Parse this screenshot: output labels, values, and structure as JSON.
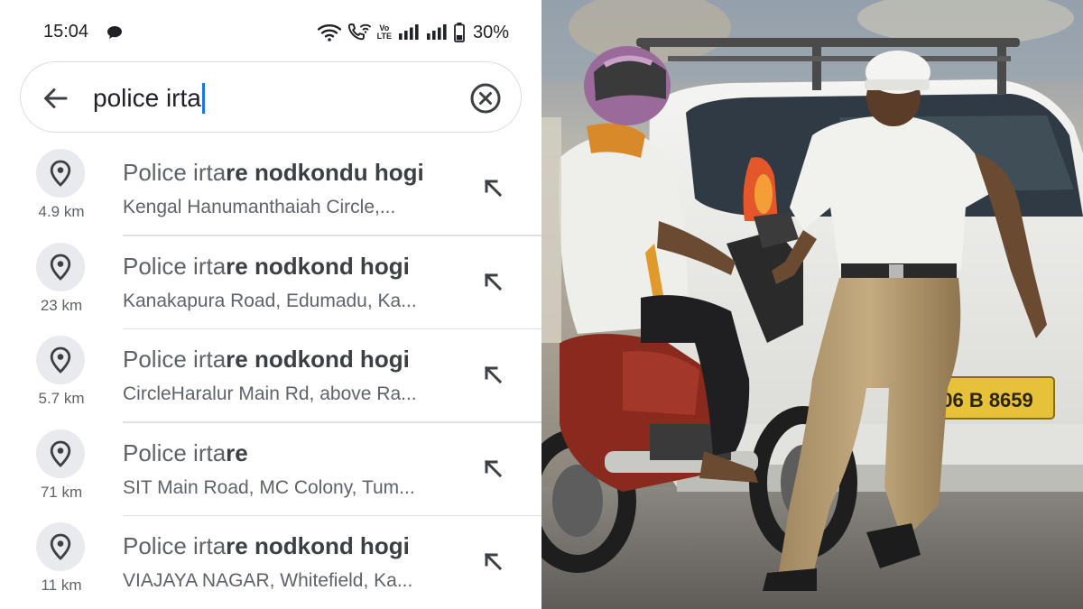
{
  "status_bar": {
    "time": "15:04",
    "battery": "30%",
    "volte_top": "Vo",
    "volte_bottom": "LTE",
    "icons": [
      "chat-bubble-icon",
      "wifi-icon",
      "wifi-calling-icon",
      "volte-icon",
      "signal-icon",
      "signal-icon",
      "battery-icon"
    ]
  },
  "search": {
    "query": "police irta",
    "back_icon": "arrow-back-icon",
    "clear_icon": "clear-circle-icon"
  },
  "results": [
    {
      "distance": "4.9 km",
      "match": "Police irta",
      "rest": "re nodkondu hogi",
      "subtitle": "Kengal Hanumanthaiah Circle,..."
    },
    {
      "distance": "23 km",
      "match": "Police irta",
      "rest": "re nodkond hogi",
      "subtitle": "Kanakapura Road, Edumadu, Ka..."
    },
    {
      "distance": "5.7 km",
      "match": "Police irta",
      "rest": "re nodkond hogi",
      "subtitle": "CircleHaralur Main Rd, above Ra..."
    },
    {
      "distance": "71 km",
      "match": "Police irta",
      "rest": "re",
      "subtitle": "SIT Main Road, MC Colony, Tum..."
    },
    {
      "distance": "11 km",
      "match": "Police irta",
      "rest": "re nodkond hogi",
      "subtitle": "VIAJAYA NAGAR, Whitefield, Ka..."
    }
  ],
  "photo": {
    "plate_text": "06 B 8659"
  },
  "colors": {
    "caret": "#1a73e8",
    "pin_bg": "#e8eaed",
    "text_primary": "#202124",
    "text_secondary": "#5f6368"
  }
}
